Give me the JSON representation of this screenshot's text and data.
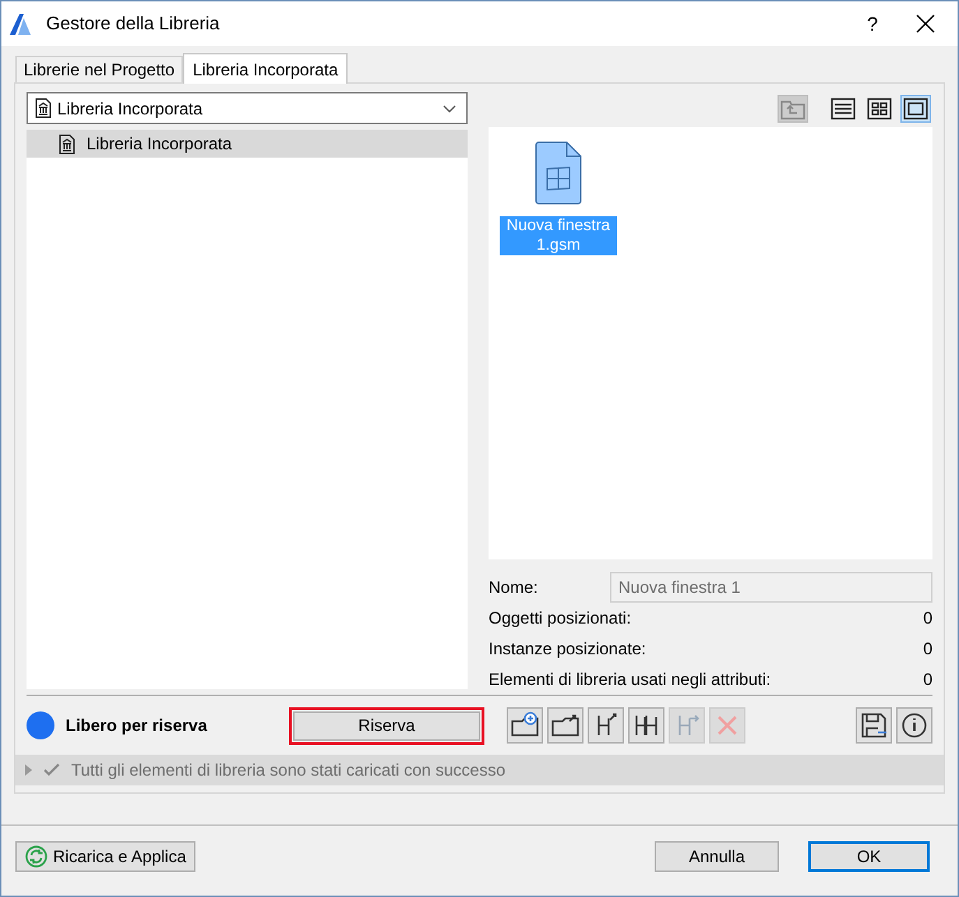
{
  "window": {
    "title": "Gestore della Libreria",
    "help": "?"
  },
  "tabs": [
    {
      "label": "Librerie nel Progetto",
      "selected": false
    },
    {
      "label": "Libreria Incorporata",
      "selected": true
    }
  ],
  "library_dropdown": {
    "value": "Libreria Incorporata"
  },
  "tree": [
    {
      "label": "Libreria Incorporata",
      "selected": true
    }
  ],
  "view_buttons": [
    {
      "kind": "folder-up",
      "disabled": true,
      "selected": false
    },
    {
      "kind": "list",
      "disabled": false,
      "selected": false
    },
    {
      "kind": "grid",
      "disabled": false,
      "selected": false
    },
    {
      "kind": "large",
      "disabled": false,
      "selected": true
    }
  ],
  "files": [
    {
      "name": "Nuova finestra 1.gsm",
      "selected": true
    }
  ],
  "details": {
    "name_label": "Nome:",
    "name_value": "Nuova finestra 1",
    "rows": [
      {
        "label": "Oggetti posizionati:",
        "value": "0"
      },
      {
        "label": "Instanze posizionate:",
        "value": "0"
      },
      {
        "label": "Elementi di libreria usati negli attributi:",
        "value": "0"
      }
    ]
  },
  "reserve": {
    "status": "Libero per riserva",
    "color": "#1e6ff0",
    "button": "Riserva"
  },
  "actions": [
    {
      "kind": "new-folder",
      "disabled": false
    },
    {
      "kind": "export-folder",
      "disabled": false
    },
    {
      "kind": "export-object",
      "disabled": false
    },
    {
      "kind": "objects",
      "disabled": false
    },
    {
      "kind": "move-object",
      "disabled": true
    },
    {
      "kind": "delete",
      "disabled": true
    }
  ],
  "side_actions": [
    {
      "kind": "save"
    },
    {
      "kind": "info"
    }
  ],
  "status_bar": {
    "message": "Tutti gli elementi di libreria sono stati caricati con successo",
    "expanded": false
  },
  "footer": {
    "reload": "Ricarica e Applica",
    "cancel": "Annulla",
    "ok": "OK"
  }
}
